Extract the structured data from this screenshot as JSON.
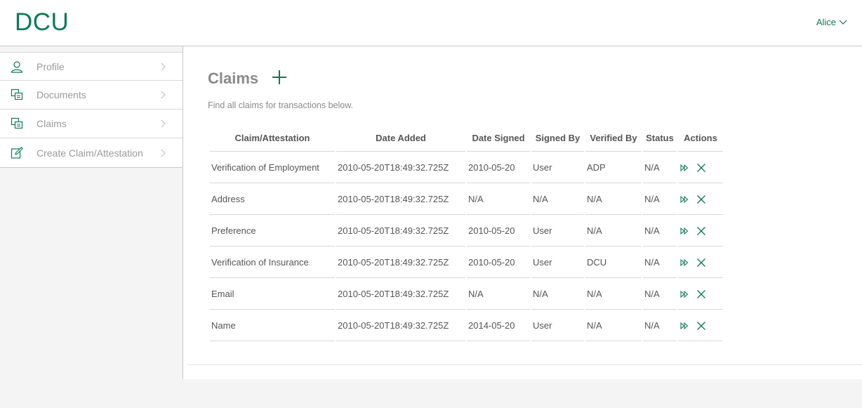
{
  "header": {
    "logo": "DCU",
    "user_name": "Alice"
  },
  "sidebar": {
    "items": [
      {
        "label": "Profile",
        "icon": "user-icon"
      },
      {
        "label": "Documents",
        "icon": "documents-icon"
      },
      {
        "label": "Claims",
        "icon": "claims-icon"
      },
      {
        "label": "Create Claim/Attestation",
        "icon": "edit-icon"
      }
    ]
  },
  "main": {
    "title": "Claims",
    "subtitle": "Find all claims for transactions below.",
    "columns": [
      "Claim/Attestation",
      "Date Added",
      "Date Signed",
      "Signed By",
      "Verified By",
      "Status",
      "Actions"
    ],
    "rows": [
      {
        "claim": "Verification of Employment",
        "date_added": "2010-05-20T18:49:32.725Z",
        "date_signed": "2010-05-20",
        "signed_by": "User",
        "verified_by": "ADP",
        "status": "N/A"
      },
      {
        "claim": "Address",
        "date_added": "2010-05-20T18:49:32.725Z",
        "date_signed": "N/A",
        "signed_by": "N/A",
        "verified_by": "N/A",
        "status": "N/A"
      },
      {
        "claim": "Preference",
        "date_added": "2010-05-20T18:49:32.725Z",
        "date_signed": "2010-05-20",
        "signed_by": "User",
        "verified_by": "N/A",
        "status": "N/A"
      },
      {
        "claim": "Verification of Insurance",
        "date_added": "2010-05-20T18:49:32.725Z",
        "date_signed": "2010-05-20",
        "signed_by": "User",
        "verified_by": "DCU",
        "status": "N/A"
      },
      {
        "claim": "Email",
        "date_added": "2010-05-20T18:49:32.725Z",
        "date_signed": "N/A",
        "signed_by": "N/A",
        "verified_by": "N/A",
        "status": "N/A"
      },
      {
        "claim": "Name",
        "date_added": "2010-05-20T18:49:32.725Z",
        "date_signed": "2014-05-20",
        "signed_by": "User",
        "verified_by": "N/A",
        "status": "N/A"
      }
    ]
  },
  "colors": {
    "accent": "#0e7a55",
    "muted_text": "#8a8a8a",
    "border": "#d7d7d7",
    "sidebar_bg": "#f4f4f4"
  }
}
